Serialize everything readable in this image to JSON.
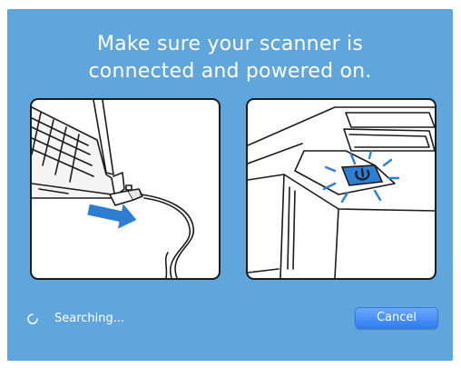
{
  "dialog": {
    "title_line1": "Make sure your scanner is",
    "title_line2": "connected and powered on.",
    "status_text": "Searching...",
    "cancel_label": "Cancel"
  },
  "illustrations": {
    "left": "laptop-usb-connection-illustration",
    "right": "scanner-power-button-illustration"
  },
  "icons": {
    "spinner": "spinner-icon",
    "power": "power-icon",
    "arrow": "arrow-right-icon"
  },
  "colors": {
    "background": "#5fa6dc",
    "text": "#ffffff",
    "button": "#2f7cf5",
    "power_button": "#2c7fd6"
  }
}
